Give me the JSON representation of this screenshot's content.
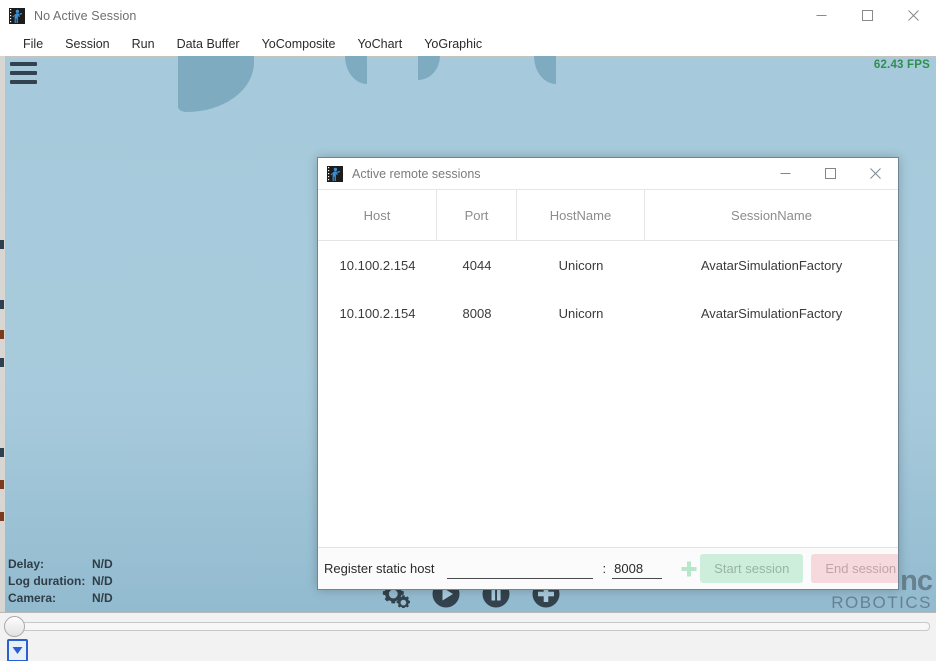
{
  "main_window": {
    "title": "No Active Session",
    "app_icon": "runner-figure-icon",
    "controls": {
      "minimize": "minimize-icon",
      "maximize": "maximize-icon",
      "close": "close-icon"
    },
    "menu": [
      {
        "label": "File"
      },
      {
        "label": "Session"
      },
      {
        "label": "Run"
      },
      {
        "label": "Data Buffer"
      },
      {
        "label": "YoComposite"
      },
      {
        "label": "YoChart"
      },
      {
        "label": "YoGraphic"
      }
    ]
  },
  "viewport": {
    "hamburger_icon": "hamburger-menu-icon",
    "fps": "62.43 FPS",
    "status": [
      {
        "label": "Delay:",
        "value": "N/D"
      },
      {
        "label": "Log duration:",
        "value": "N/D"
      },
      {
        "label": "Camera:",
        "value": "N/D"
      }
    ],
    "playback": [
      {
        "icon": "gears-settings-icon"
      },
      {
        "icon": "play-icon"
      },
      {
        "icon": "pause-icon"
      },
      {
        "icon": "plus-circle-icon"
      }
    ],
    "watermark": {
      "line1": "nc",
      "line2": "ROBOTICS"
    }
  },
  "bottom_panel": {
    "slider_name": "timeline-slider",
    "combo_icon": "dropdown-arrow-icon"
  },
  "dialog": {
    "title": "Active remote sessions",
    "icon": "runner-figure-icon",
    "controls": {
      "minimize": "minimize-icon",
      "maximize": "maximize-icon",
      "close": "close-icon"
    },
    "table": {
      "columns": [
        "Host",
        "Port",
        "HostName",
        "SessionName"
      ],
      "rows": [
        {
          "host": "10.100.2.154",
          "port": "4044",
          "hostname": "Unicorn",
          "sessionname": "AvatarSimulationFactory"
        },
        {
          "host": "10.100.2.154",
          "port": "8008",
          "hostname": "Unicorn",
          "sessionname": "AvatarSimulationFactory"
        }
      ]
    },
    "footer": {
      "register_label": "Register static host",
      "host_value": "",
      "host_placeholder": "",
      "colon": ":",
      "port_value": "8008",
      "add_icon": "plus-icon",
      "start_button": "Start session",
      "end_button": "End session"
    }
  },
  "colors": {
    "viewport_blue": "#a8cbdc",
    "accent_green": "#2f8f4e",
    "start_button_bg": "#cdeedb",
    "end_button_bg": "#f6d9dd",
    "add_icon": "#b6e7cb"
  }
}
